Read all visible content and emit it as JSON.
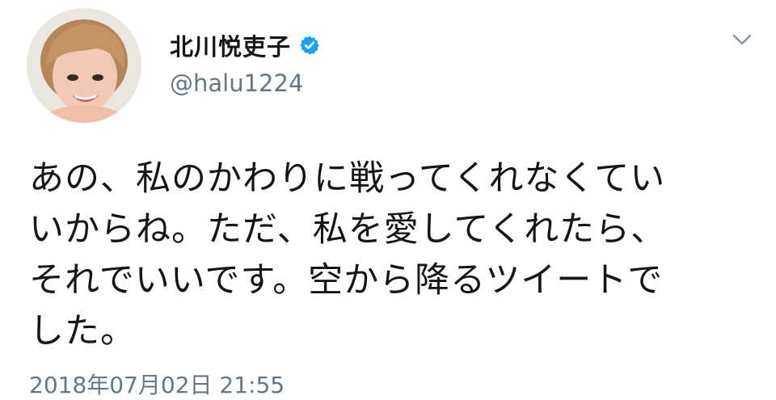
{
  "tweet": {
    "display_name": "北川悦吏子",
    "handle": "@halu1224",
    "text": "あの、私のかわりに戦ってくれなくてい\nいからね。ただ、私を愛してくれたら、\nそれでいいです。空から降るツイートで\nした。",
    "timestamp": "2018年07月02日 21:55"
  },
  "icons": {
    "verified": "verified-badge-icon",
    "caret": "chevron-down-icon"
  },
  "colors": {
    "verified": "#1da1f2",
    "secondary_text": "#657786",
    "primary_text": "#14171a"
  }
}
